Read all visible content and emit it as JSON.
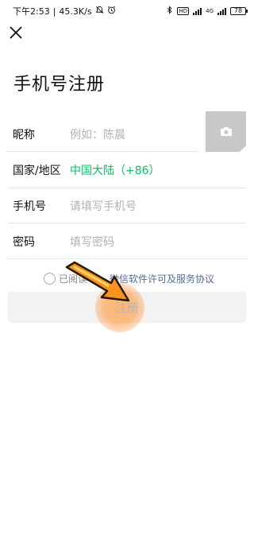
{
  "status_bar": {
    "time": "下午2:53",
    "speed": "45.3K/s",
    "network": "4G",
    "battery": "78"
  },
  "header": {
    "title": "手机号注册"
  },
  "form": {
    "nickname": {
      "label": "昵称",
      "placeholder": "例如：陈晨"
    },
    "region": {
      "label": "国家/地区",
      "value": "中国大陆（+86）"
    },
    "phone": {
      "label": "手机号",
      "placeholder": "请填写手机号"
    },
    "password": {
      "label": "密码",
      "placeholder": "填写密码"
    }
  },
  "agreement": {
    "prefix": "已阅读",
    "link": "微信软件许可及服务协议"
  },
  "register_button": {
    "label": "注册"
  },
  "colors": {
    "accent_green": "#07c160",
    "link_blue": "#576b95",
    "placeholder": "#b2b2b2",
    "button_bg": "#f2f2f2",
    "arrow_orange": "#f7931e"
  },
  "icons": {
    "close": "close-icon",
    "camera": "camera-icon",
    "bluetooth": "bluetooth-icon",
    "alarm": "alarm-icon",
    "mute": "mute-icon"
  }
}
